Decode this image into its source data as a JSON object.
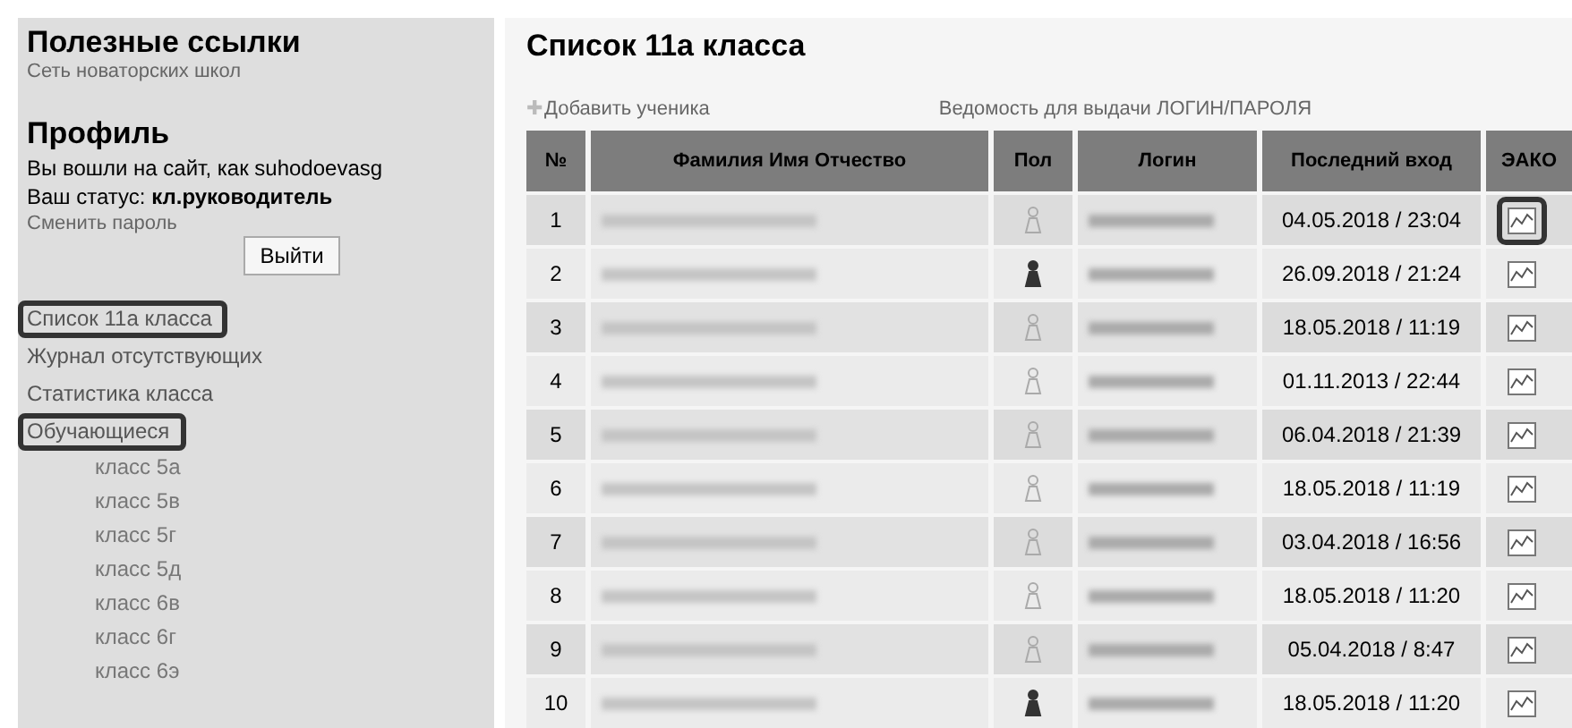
{
  "sidebar": {
    "links_title": "Полезные ссылки",
    "links": [
      "Сеть новаторских школ"
    ],
    "profile_title": "Профиль",
    "login_line": "Вы вошли на сайт, как suhodoevasg",
    "status_line": "Ваш статус: **кл.руководитель**",
    "change_password": "Сменить пароль",
    "logout_button": "Выйти",
    "menu": [
      {
        "label": "Список 11а класса",
        "circled": true
      },
      {
        "label": "Журнал отсутствующих",
        "circled": false
      },
      {
        "label": "Статистика класса",
        "circled": false
      },
      {
        "label": "Обучающиеся",
        "circled": true,
        "children": [
          {
            "label": "класс 5а"
          },
          {
            "label": "класс 5в"
          },
          {
            "label": "класс 5г"
          },
          {
            "label": "класс 5д"
          },
          {
            "label": "класс 6в"
          },
          {
            "label": "класс 6г"
          },
          {
            "label": "класс 6э"
          }
        ]
      }
    ]
  },
  "main": {
    "title": "Список 11а класса",
    "add_icon": "✚",
    "add_link": "Добавить ученика",
    "sheet_link": "Ведомость для выдачи ЛОГИН/ПАРОЛЯ",
    "table": {
      "columns": [
        "№",
        "Фамилия Имя Отчество",
        "Пол",
        "Логин",
        "Последний вход",
        "ЭАКО"
      ],
      "rows": [
        {
          "number": "1",
          "filled_icon": false,
          "last_login": "04.05.2018 / 23:04",
          "circled": true
        },
        {
          "number": "2",
          "filled_icon": true,
          "last_login": "26.09.2018 / 21:24",
          "circled": false
        },
        {
          "number": "3",
          "filled_icon": false,
          "last_login": "18.05.2018 / 11:19",
          "circled": false
        },
        {
          "number": "4",
          "filled_icon": false,
          "last_login": "01.11.2013 / 22:44",
          "circled": false
        },
        {
          "number": "5",
          "filled_icon": false,
          "last_login": "06.04.2018 / 21:39",
          "circled": false
        },
        {
          "number": "6",
          "filled_icon": false,
          "last_login": "18.05.2018 / 11:19",
          "circled": false
        },
        {
          "number": "7",
          "filled_icon": false,
          "last_login": "03.04.2018 / 16:56",
          "circled": false
        },
        {
          "number": "8",
          "filled_icon": false,
          "last_login": "18.05.2018 / 11:20",
          "circled": false
        },
        {
          "number": "9",
          "filled_icon": false,
          "last_login": "05.04.2018 / 8:47",
          "circled": false
        },
        {
          "number": "10",
          "filled_icon": true,
          "last_login": "18.05.2018 / 11:20",
          "circled": false
        }
      ]
    }
  }
}
